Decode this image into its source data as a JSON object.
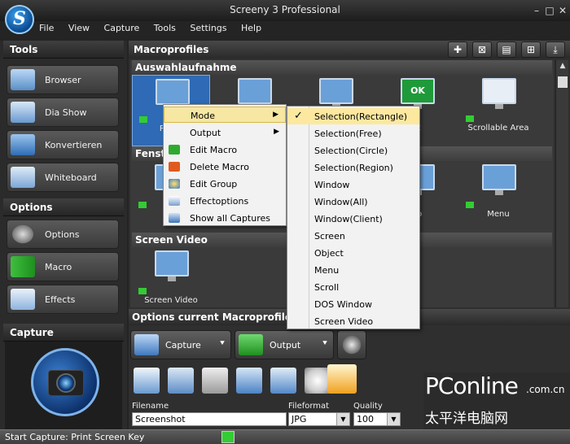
{
  "window": {
    "title": "Screeny 3 Professional",
    "controls": [
      "–",
      "□",
      "✕"
    ],
    "logo_letter": "S"
  },
  "menubar": [
    "File",
    "View",
    "Capture",
    "Tools",
    "Settings",
    "Help"
  ],
  "sidebar": {
    "tools_title": "Tools",
    "tools": [
      "Browser",
      "Dia Show",
      "Konvertieren",
      "Whiteboard"
    ],
    "options_title": "Options",
    "options": [
      "Options",
      "Macro",
      "Effects"
    ],
    "capture_title": "Capture"
  },
  "main": {
    "title": "Macroprofiles",
    "groups": [
      {
        "name": "Auswahlaufnahme",
        "tiles": [
          "Recta",
          "",
          "",
          "ct",
          "Scrollable Area"
        ]
      },
      {
        "name": "Fenste",
        "tiles": [
          "W",
          "",
          "",
          "op",
          "Menu"
        ]
      },
      {
        "name": "Screen Video",
        "tiles": [
          "Screen Video"
        ]
      }
    ],
    "ok_label": "OK",
    "options_title": "Options current Macroprofile",
    "capture_btn": "Capture",
    "output_btn": "Output",
    "filename_label": "Filename",
    "filename_value": "Screenshot",
    "fileformat_label": "Fileformat",
    "fileformat_value": "JPG",
    "quality_label": "Quality",
    "quality_value": "100"
  },
  "context_menu": {
    "items": [
      "Mode",
      "Output",
      "Edit Macro",
      "Delete Macro",
      "Edit Group",
      "Effectoptions",
      "Show all Captures"
    ],
    "highlighted": "Mode"
  },
  "submenu": {
    "checked": "Selection(Rectangle)",
    "check_mark": "✓",
    "items": [
      "Selection(Rectangle)",
      "Selection(Free)",
      "Selection(Circle)",
      "Selection(Region)",
      "Window",
      "Window(All)",
      "Window(Client)",
      "Screen",
      "Object",
      "Menu",
      "Scroll",
      "DOS Window",
      "Screen Video"
    ]
  },
  "status": "Start Capture: Print Screen Key",
  "watermark": {
    "brand": "PConline",
    "domain": ".com.cn",
    "cn": "太平洋电脑网"
  },
  "colors": {
    "selected_tile": "#2e6ab5",
    "menu_highlight": "#f6e7a2"
  }
}
